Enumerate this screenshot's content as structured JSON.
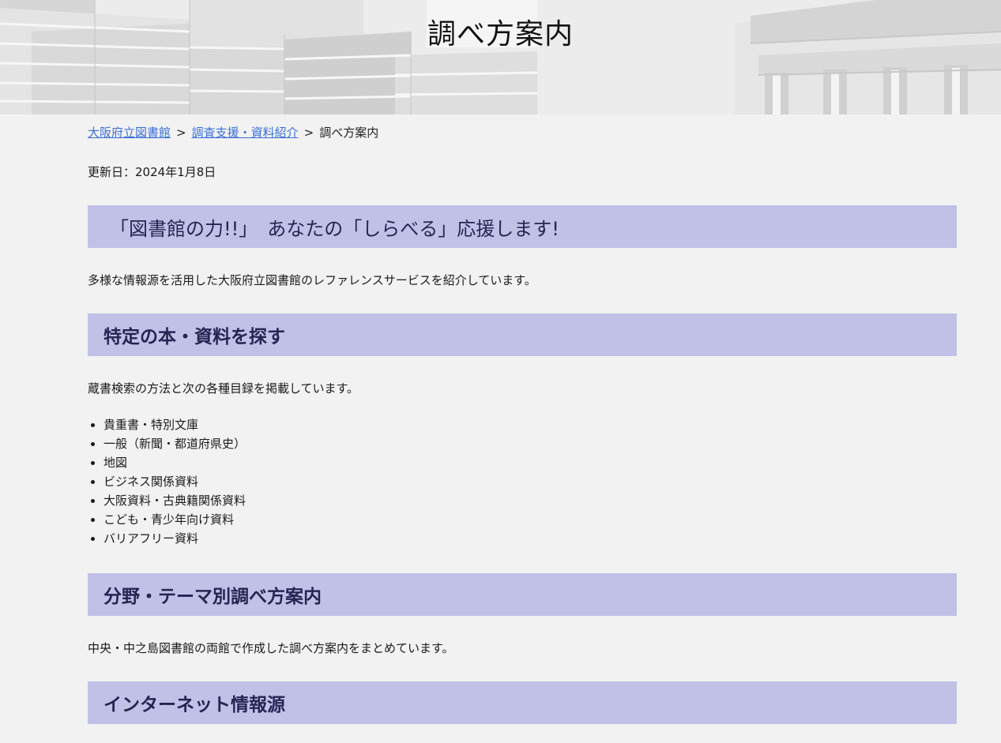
{
  "page": {
    "title": "調べ方案内"
  },
  "breadcrumb": {
    "items": [
      {
        "label": "大阪府立図書館",
        "link": true
      },
      {
        "label": "調査支援・資料紹介",
        "link": true
      },
      {
        "label": "調べ方案内",
        "link": false
      }
    ],
    "separator": ">"
  },
  "updated": "更新日：2024年1月8日",
  "sections": [
    {
      "heading": "「図書館の力!!」　あなたの「しらべる」応援します!",
      "text": "多様な情報源を活用した大阪府立図書館のレファレンスサービスを紹介しています。"
    },
    {
      "heading": "特定の本・資料を探す",
      "text": "蔵書検索の方法と次の各種目録を掲載しています。",
      "items": [
        "貴重書・特別文庫",
        "一般（新聞・都道府県史）",
        "地図",
        "ビジネス関係資料",
        "大阪資料・古典籍関係資料",
        "こども・青少年向け資料",
        "バリアフリー資料"
      ]
    },
    {
      "heading": "分野・テーマ別調べ方案内",
      "text": "中央・中之島図書館の両館で作成した調べ方案内をまとめています。"
    },
    {
      "heading": "インターネット情報源"
    }
  ]
}
